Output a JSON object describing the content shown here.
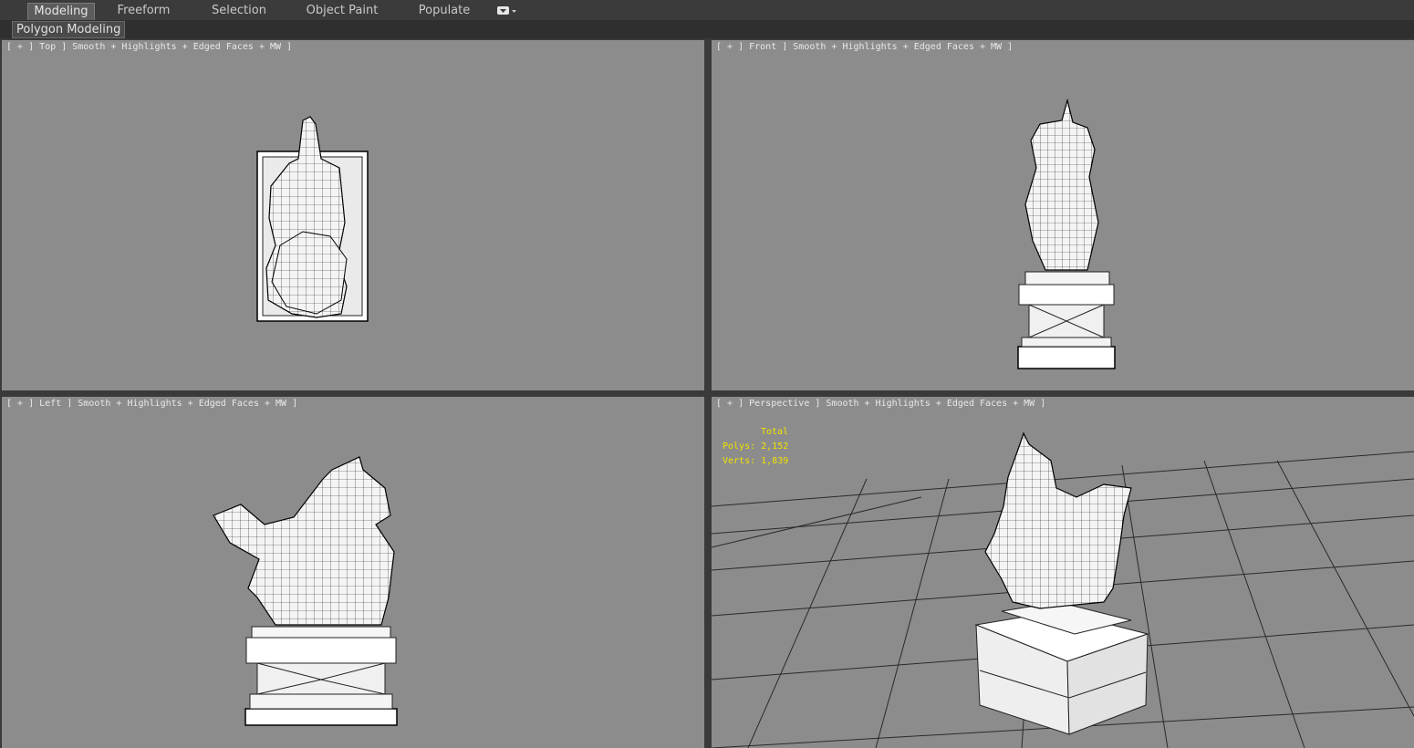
{
  "ribbon": {
    "tabs": [
      {
        "label": "Modeling",
        "active": true
      },
      {
        "label": "Freeform"
      },
      {
        "label": "Selection"
      },
      {
        "label": "Object Paint"
      },
      {
        "label": "Populate"
      }
    ],
    "dropdown_icon": "chevron-down-icon"
  },
  "subribbon": {
    "label": "Polygon Modeling"
  },
  "viewports": {
    "top": {
      "label": "[ + ] Top ] Smooth + Highlights + Edged Faces + MW ]"
    },
    "front": {
      "label": "[ + ] Front ] Smooth + Highlights + Edged Faces + MW ]"
    },
    "left": {
      "label": "[ + ] Left ] Smooth + Highlights + Edged Faces + MW ]"
    },
    "perspective": {
      "label": "[ + ] Perspective ] Smooth + Highlights + Edged Faces + MW ]",
      "stats": {
        "title": "Total",
        "polys": "Polys: 2,152",
        "verts": "Verts: 1,839"
      }
    }
  },
  "colors": {
    "viewport_bg": "#8c8c8c",
    "stats_text": "#f2e300",
    "ui_dark": "#3b3b3b"
  }
}
